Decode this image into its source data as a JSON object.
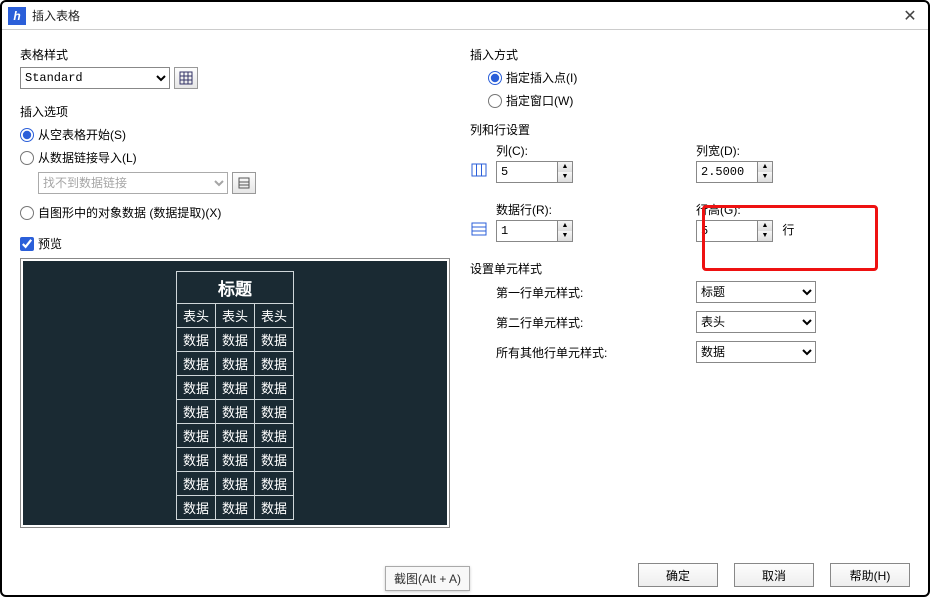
{
  "window": {
    "title": "插入表格"
  },
  "left": {
    "style_section": "表格样式",
    "style_value": "Standard",
    "insert_options": "插入选项",
    "opt_empty": "从空表格开始(S)",
    "opt_datalink": "从数据链接导入(L)",
    "datalink_value": "找不到数据链接",
    "opt_extract": "自图形中的对象数据 (数据提取)(X)",
    "preview_label": "预览"
  },
  "preview": {
    "title": "标题",
    "header": "表头",
    "data": "数据"
  },
  "right": {
    "insert_mode": "插入方式",
    "mode_point": "指定插入点(I)",
    "mode_window": "指定窗口(W)",
    "colrow_section": "列和行设置",
    "col_label": "列(C):",
    "col_value": "5",
    "colw_label": "列宽(D):",
    "colw_value": "2.5000",
    "datarow_label": "数据行(R):",
    "datarow_value": "1",
    "rowh_label": "行高(G):",
    "rowh_value": "5",
    "rowh_unit": "行",
    "cellstyle_section": "设置单元样式",
    "row1_label": "第一行单元样式:",
    "row1_value": "标题",
    "row2_label": "第二行单元样式:",
    "row2_value": "表头",
    "rowother_label": "所有其他行单元样式:",
    "rowother_value": "数据"
  },
  "footer": {
    "ok": "确定",
    "cancel": "取消",
    "help": "帮助(H)"
  },
  "overlay": {
    "snip": "截图(Alt + A)"
  }
}
